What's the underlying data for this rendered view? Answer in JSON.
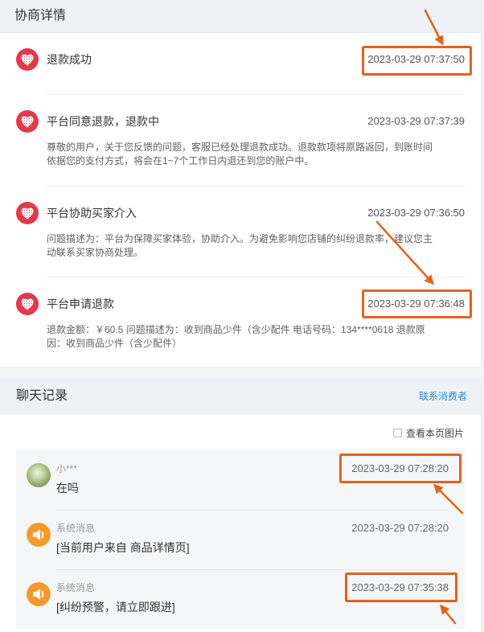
{
  "negotiation": {
    "title": "协商详情",
    "items": [
      {
        "title": "退款成功",
        "time": "2023-03-29 07:37:50"
      },
      {
        "title": "平台同意退款，退款中",
        "time": "2023-03-29 07:37:39",
        "description": [
          "尊敬的用户，关于您反馈的问题，客服已经处理退款成功。退款款项将原路返回，到账时间",
          "依据您的支付方式，将会在1~7个工作日内退还到您的账户中。"
        ]
      },
      {
        "title": "平台协助买家介入",
        "time": "2023-03-29 07:36:50",
        "description": [
          "问题描述为：平台为保障买家体验，协助介入。为避免影响您店铺的纠纷退款率，建议您主",
          "动联系买家协商处理。"
        ]
      },
      {
        "title": "平台申请退款",
        "time": "2023-03-29 07:36:48",
        "description": [
          "退款金额：￥60.5 问题描述为：收到商品少件（含少配件 电话号码：134****0618 退款原",
          "因：收到商品少件（含少配件）"
        ]
      }
    ]
  },
  "chat": {
    "title": "聊天记录",
    "contact_link": "联系消费者",
    "view_images_label": "查看本页图片",
    "messages": [
      {
        "sender": "小***",
        "time": "2023-03-29 07:28:20",
        "text": "在吗"
      },
      {
        "sender": "系统消息",
        "time": "2023-03-29 07:28:20",
        "text": "[当前用户来自 商品详情页]"
      },
      {
        "sender": "系统消息",
        "time": "2023-03-29 07:35:38",
        "text": "[纠纷预警，请立即跟进]"
      }
    ]
  },
  "icons": {
    "negotiation_item": "heart-badge-icon",
    "system_message": "speaker-icon",
    "user_message": "avatar"
  },
  "colors": {
    "accent_red": "#e03a4c",
    "system_orange": "#f29a2e",
    "link": "#2b8dd0",
    "annotation": "#e4611e"
  }
}
